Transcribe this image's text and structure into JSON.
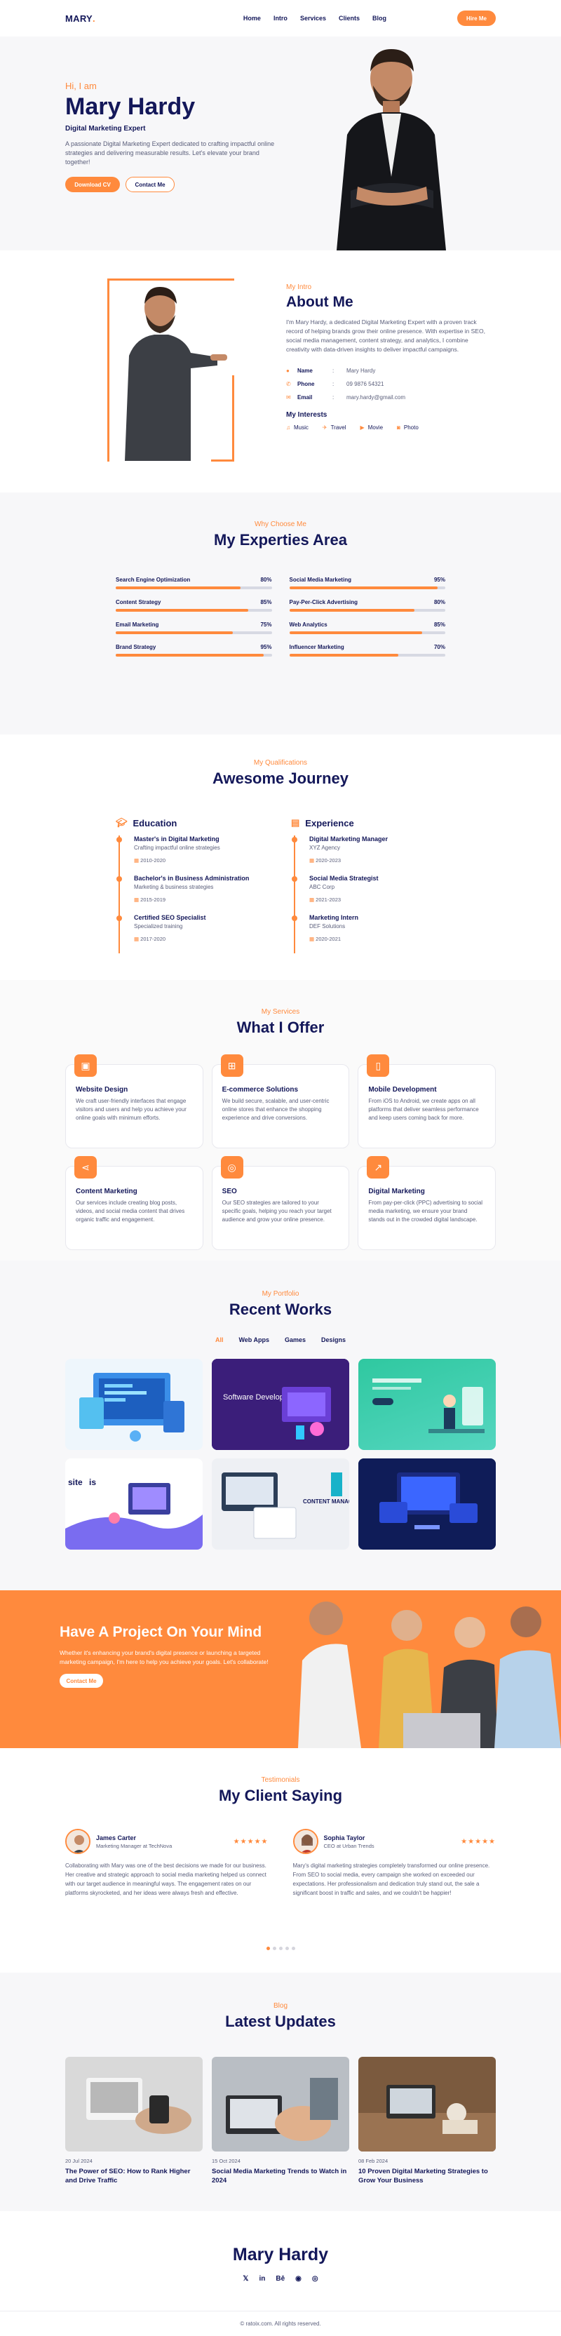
{
  "nav": {
    "logo": "MARY",
    "logo_dot": ".",
    "items": [
      {
        "label": "Home"
      },
      {
        "label": "Intro"
      },
      {
        "label": "Services"
      },
      {
        "label": "Clients"
      },
      {
        "label": "Blog"
      }
    ],
    "hire_label": "Hire Me"
  },
  "hero": {
    "greeting": "Hi, I am",
    "name": "Mary Hardy",
    "role": "Digital Marketing Expert",
    "description": "A passionate Digital Marketing Expert dedicated to crafting impactful online strategies and delivering measurable results. Let's elevate your brand together!",
    "download_label": "Download CV",
    "contact_label": "Contact Me"
  },
  "about": {
    "subtitle": "My Intro",
    "title": "About Me",
    "description": "I'm Mary Hardy, a dedicated Digital Marketing Expert with a proven track record of helping brands grow their online presence. With expertise in SEO, social media management, content strategy, and analytics, I combine creativity with data-driven insights to deliver impactful campaigns.",
    "info": [
      {
        "key": "Name",
        "value": "Mary Hardy",
        "icon": "user-icon"
      },
      {
        "key": "Phone",
        "value": "09 9876 54321",
        "icon": "phone-icon"
      },
      {
        "key": "Email",
        "value": "mary.hardy@gmail.com",
        "icon": "mail-icon"
      }
    ],
    "interests_title": "My Interests",
    "interests": [
      {
        "label": "Music",
        "icon": "music-icon"
      },
      {
        "label": "Travel",
        "icon": "plane-icon"
      },
      {
        "label": "Movie",
        "icon": "film-icon"
      },
      {
        "label": "Photo",
        "icon": "camera-icon"
      }
    ]
  },
  "skills": {
    "subtitle": "Why Choose Me",
    "title": "My Experties Area",
    "items": [
      {
        "name": "Search Engine Optimization",
        "percent_label": "80%",
        "value": 80
      },
      {
        "name": "Social Media Marketing",
        "percent_label": "95%",
        "value": 95
      },
      {
        "name": "Content Strategy",
        "percent_label": "85%",
        "value": 85
      },
      {
        "name": "Pay-Per-Click Advertising",
        "percent_label": "80%",
        "value": 80
      },
      {
        "name": "Email Marketing",
        "percent_label": "75%",
        "value": 75
      },
      {
        "name": "Web Analytics",
        "percent_label": "85%",
        "value": 85
      },
      {
        "name": "Brand Strategy",
        "percent_label": "95%",
        "value": 95
      },
      {
        "name": "Influencer Marketing",
        "percent_label": "70%",
        "value": 70
      }
    ]
  },
  "journey": {
    "subtitle": "My Qualifications",
    "title": "Awesome Journey",
    "education_title": "Education",
    "experience_title": "Experience",
    "education": [
      {
        "title": "Master's in Digital Marketing",
        "org": "Crafting impactful online strategies",
        "date": "2010-2020"
      },
      {
        "title": "Bachelor's in Business Administration",
        "org": "Marketing & business strategies",
        "date": "2015-2019"
      },
      {
        "title": "Certified SEO Specialist",
        "org": "Specialized training",
        "date": "2017-2020"
      }
    ],
    "experience": [
      {
        "title": "Digital Marketing Manager",
        "org": "XYZ Agency",
        "date": "2020-2023"
      },
      {
        "title": "Social Media Strategist",
        "org": "ABC Corp",
        "date": "2021-2023"
      },
      {
        "title": "Marketing Intern",
        "org": "DEF Solutions",
        "date": "2020-2021"
      }
    ]
  },
  "services": {
    "subtitle": "My Services",
    "title": "What I Offer",
    "items": [
      {
        "title": "Website Design",
        "icon": "browser-icon",
        "glyph": "▣",
        "desc": "We craft user-friendly interfaces that engage visitors and users and help you achieve your online goals with minimum efforts."
      },
      {
        "title": "E-commerce Solutions",
        "icon": "cart-icon",
        "glyph": "⊞",
        "desc": "We build secure, scalable, and user-centric online stores that enhance the shopping experience and drive conversions."
      },
      {
        "title": "Mobile Development",
        "icon": "mobile-icon",
        "glyph": "▯",
        "desc": "From iOS to Android, we create apps on all platforms that deliver seamless performance and keep users coming back for more."
      },
      {
        "title": "Content Marketing",
        "icon": "share-icon",
        "glyph": "⋖",
        "desc": "Our services include creating blog posts, videos, and social media content that drives organic traffic and engagement."
      },
      {
        "title": "SEO",
        "icon": "seo-icon",
        "glyph": "◎",
        "desc": "Our SEO strategies are tailored to your specific goals, helping you reach your target audience and grow your online presence."
      },
      {
        "title": "Digital Marketing",
        "icon": "megaphone-icon",
        "glyph": "↗",
        "desc": "From pay-per-click (PPC) advertising to social media marketing, we ensure your brand stands out in the crowded digital landscape."
      }
    ]
  },
  "portfolio": {
    "subtitle": "My Portfolio",
    "title": "Recent Works",
    "filters": [
      {
        "label": "All",
        "active": true
      },
      {
        "label": "Web Apps"
      },
      {
        "label": "Games"
      },
      {
        "label": "Designs"
      }
    ],
    "works_text": {
      "w2": "Software Development",
      "w5a": "site",
      "w5b": "is",
      "w6": "CONTENT MANAGEMENT"
    }
  },
  "cta": {
    "title": "Have A Project On Your Mind",
    "description": "Whether it's enhancing your brand's digital presence or launching a targeted marketing campaign, I'm here to help you achieve your goals. Let's collaborate!",
    "button_label": "Contact Me"
  },
  "testimonials": {
    "subtitle": "Testimonials",
    "title": "My Client Saying",
    "stars": "★★★★★",
    "items": [
      {
        "name": "James Carter",
        "role": "Marketing Manager at TechNova",
        "text": "Collaborating with Mary was one of the best decisions we made for our business. Her creative and strategic approach to social media marketing helped us connect with our target audience in meaningful ways. The engagement rates on our platforms skyrocketed, and her ideas were always fresh and effective."
      },
      {
        "name": "Sophia Taylor",
        "role": "CEO at Urban Trends",
        "text": "Mary's digital marketing strategies completely transformed our online presence. From SEO to social media, every campaign she worked on exceeded our expectations. Her professionalism and dedication truly stand out, the sale a significant boost in traffic and sales, and we couldn't be happier!"
      }
    ]
  },
  "blog": {
    "subtitle": "Blog",
    "title": "Latest Updates",
    "posts": [
      {
        "date": "20 Jul 2024",
        "title": "The Power of SEO: How to Rank Higher and Drive Traffic"
      },
      {
        "date": "15 Oct 2024",
        "title": "Social Media Marketing Trends to Watch in 2024"
      },
      {
        "date": "08 Feb 2024",
        "title": "10 Proven Digital Marketing Strategies to Grow Your Business"
      }
    ]
  },
  "footer": {
    "name": "Mary Hardy",
    "socials": [
      {
        "label": "𝕏",
        "icon": "twitter-icon"
      },
      {
        "label": "in",
        "icon": "linkedin-icon"
      },
      {
        "label": "Bē",
        "icon": "behance-icon"
      },
      {
        "label": "◉",
        "icon": "dribbble-icon"
      },
      {
        "label": "◎",
        "icon": "instagram-icon"
      }
    ],
    "copyright": "© ratoix.com. All rights reserved."
  },
  "colors": {
    "accent": "#ff8a3d",
    "navy": "#14185a"
  }
}
